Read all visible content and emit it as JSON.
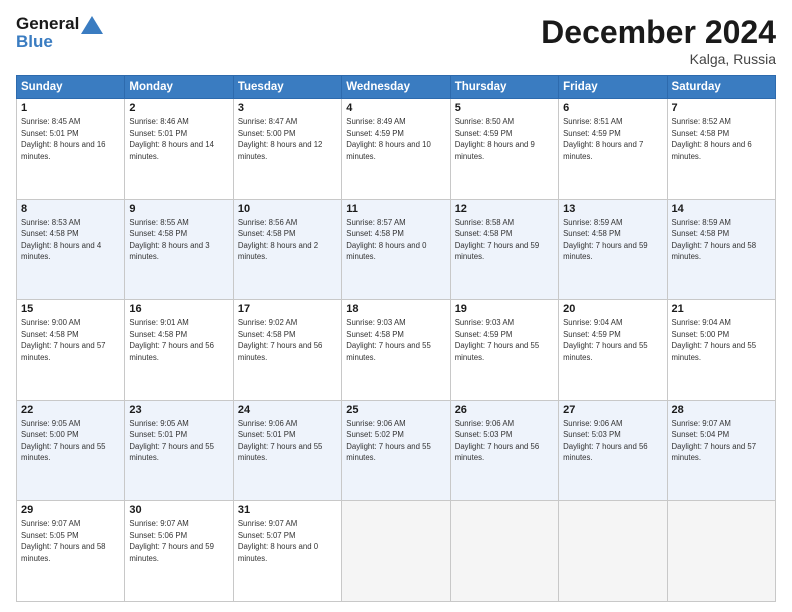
{
  "header": {
    "logo_line1": "General",
    "logo_line2": "Blue",
    "month": "December 2024",
    "location": "Kalga, Russia"
  },
  "weekdays": [
    "Sunday",
    "Monday",
    "Tuesday",
    "Wednesday",
    "Thursday",
    "Friday",
    "Saturday"
  ],
  "weeks": [
    [
      {
        "day": "1",
        "sunrise": "8:45 AM",
        "sunset": "5:01 PM",
        "daylight": "8 hours and 16 minutes."
      },
      {
        "day": "2",
        "sunrise": "8:46 AM",
        "sunset": "5:01 PM",
        "daylight": "8 hours and 14 minutes."
      },
      {
        "day": "3",
        "sunrise": "8:47 AM",
        "sunset": "5:00 PM",
        "daylight": "8 hours and 12 minutes."
      },
      {
        "day": "4",
        "sunrise": "8:49 AM",
        "sunset": "4:59 PM",
        "daylight": "8 hours and 10 minutes."
      },
      {
        "day": "5",
        "sunrise": "8:50 AM",
        "sunset": "4:59 PM",
        "daylight": "8 hours and 9 minutes."
      },
      {
        "day": "6",
        "sunrise": "8:51 AM",
        "sunset": "4:59 PM",
        "daylight": "8 hours and 7 minutes."
      },
      {
        "day": "7",
        "sunrise": "8:52 AM",
        "sunset": "4:58 PM",
        "daylight": "8 hours and 6 minutes."
      }
    ],
    [
      {
        "day": "8",
        "sunrise": "8:53 AM",
        "sunset": "4:58 PM",
        "daylight": "8 hours and 4 minutes."
      },
      {
        "day": "9",
        "sunrise": "8:55 AM",
        "sunset": "4:58 PM",
        "daylight": "8 hours and 3 minutes."
      },
      {
        "day": "10",
        "sunrise": "8:56 AM",
        "sunset": "4:58 PM",
        "daylight": "8 hours and 2 minutes."
      },
      {
        "day": "11",
        "sunrise": "8:57 AM",
        "sunset": "4:58 PM",
        "daylight": "8 hours and 0 minutes."
      },
      {
        "day": "12",
        "sunrise": "8:58 AM",
        "sunset": "4:58 PM",
        "daylight": "7 hours and 59 minutes."
      },
      {
        "day": "13",
        "sunrise": "8:59 AM",
        "sunset": "4:58 PM",
        "daylight": "7 hours and 59 minutes."
      },
      {
        "day": "14",
        "sunrise": "8:59 AM",
        "sunset": "4:58 PM",
        "daylight": "7 hours and 58 minutes."
      }
    ],
    [
      {
        "day": "15",
        "sunrise": "9:00 AM",
        "sunset": "4:58 PM",
        "daylight": "7 hours and 57 minutes."
      },
      {
        "day": "16",
        "sunrise": "9:01 AM",
        "sunset": "4:58 PM",
        "daylight": "7 hours and 56 minutes."
      },
      {
        "day": "17",
        "sunrise": "9:02 AM",
        "sunset": "4:58 PM",
        "daylight": "7 hours and 56 minutes."
      },
      {
        "day": "18",
        "sunrise": "9:03 AM",
        "sunset": "4:58 PM",
        "daylight": "7 hours and 55 minutes."
      },
      {
        "day": "19",
        "sunrise": "9:03 AM",
        "sunset": "4:59 PM",
        "daylight": "7 hours and 55 minutes."
      },
      {
        "day": "20",
        "sunrise": "9:04 AM",
        "sunset": "4:59 PM",
        "daylight": "7 hours and 55 minutes."
      },
      {
        "day": "21",
        "sunrise": "9:04 AM",
        "sunset": "5:00 PM",
        "daylight": "7 hours and 55 minutes."
      }
    ],
    [
      {
        "day": "22",
        "sunrise": "9:05 AM",
        "sunset": "5:00 PM",
        "daylight": "7 hours and 55 minutes."
      },
      {
        "day": "23",
        "sunrise": "9:05 AM",
        "sunset": "5:01 PM",
        "daylight": "7 hours and 55 minutes."
      },
      {
        "day": "24",
        "sunrise": "9:06 AM",
        "sunset": "5:01 PM",
        "daylight": "7 hours and 55 minutes."
      },
      {
        "day": "25",
        "sunrise": "9:06 AM",
        "sunset": "5:02 PM",
        "daylight": "7 hours and 55 minutes."
      },
      {
        "day": "26",
        "sunrise": "9:06 AM",
        "sunset": "5:03 PM",
        "daylight": "7 hours and 56 minutes."
      },
      {
        "day": "27",
        "sunrise": "9:06 AM",
        "sunset": "5:03 PM",
        "daylight": "7 hours and 56 minutes."
      },
      {
        "day": "28",
        "sunrise": "9:07 AM",
        "sunset": "5:04 PM",
        "daylight": "7 hours and 57 minutes."
      }
    ],
    [
      {
        "day": "29",
        "sunrise": "9:07 AM",
        "sunset": "5:05 PM",
        "daylight": "7 hours and 58 minutes."
      },
      {
        "day": "30",
        "sunrise": "9:07 AM",
        "sunset": "5:06 PM",
        "daylight": "7 hours and 59 minutes."
      },
      {
        "day": "31",
        "sunrise": "9:07 AM",
        "sunset": "5:07 PM",
        "daylight": "8 hours and 0 minutes."
      },
      null,
      null,
      null,
      null
    ]
  ]
}
